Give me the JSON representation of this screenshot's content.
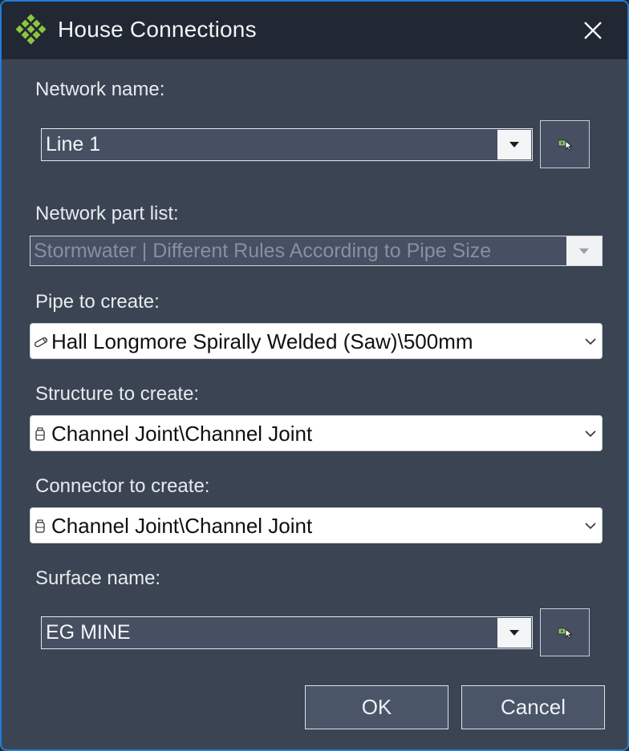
{
  "window": {
    "title": "House Connections",
    "accent_color": "#1e7fd6",
    "app_icon": "green-grid-logo-icon"
  },
  "network_name": {
    "label": "Network name:",
    "value": "Line 1"
  },
  "part_list": {
    "label": "Network part list:",
    "value": "Stormwater | Different Rules According to Pipe Size",
    "enabled": false
  },
  "pipe": {
    "label": "Pipe to create:",
    "value": "Hall Longmore Spirally Welded (Saw)\\500mm",
    "icon": "pipe-icon"
  },
  "structure": {
    "label": "Structure to create:",
    "value": "Channel Joint\\Channel Joint",
    "icon": "structure-icon"
  },
  "connector": {
    "label": "Connector to create:",
    "value": "Channel Joint\\Channel Joint",
    "icon": "structure-icon"
  },
  "surface": {
    "label": "Surface name:",
    "value": "EG MINE"
  },
  "buttons": {
    "ok": "OK",
    "cancel": "Cancel"
  }
}
